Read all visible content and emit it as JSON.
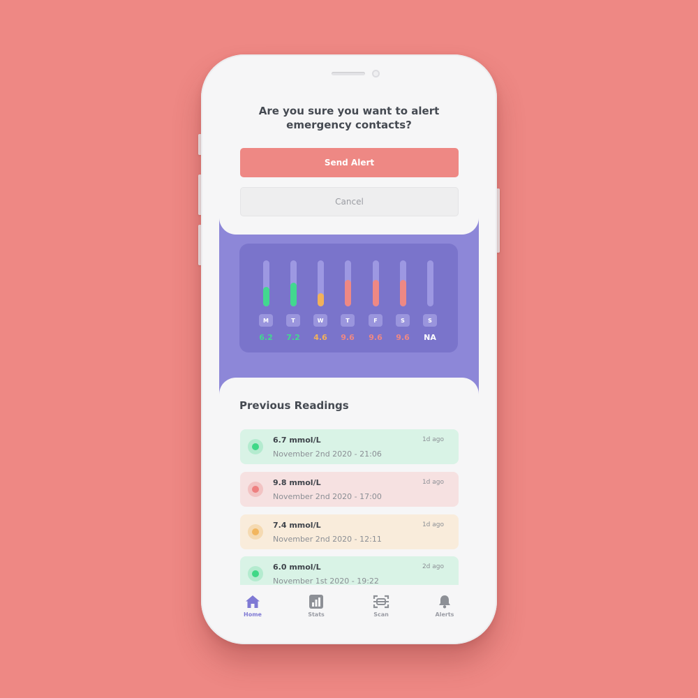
{
  "dialog": {
    "title": "Are you sure you want to alert\nemergency contacts?",
    "send_label": "Send Alert",
    "cancel_label": "Cancel"
  },
  "weekly_chart": {
    "days": [
      {
        "label": "M",
        "value": "6.2",
        "level": 0.42,
        "color": "#42d88f"
      },
      {
        "label": "T",
        "value": "7.2",
        "level": 0.52,
        "color": "#42d88f"
      },
      {
        "label": "W",
        "value": "4.6",
        "level": 0.29,
        "color": "#f2b15a"
      },
      {
        "label": "T",
        "value": "9.6",
        "level": 0.58,
        "color": "#ee8884"
      },
      {
        "label": "F",
        "value": "9.6",
        "level": 0.58,
        "color": "#ee8884"
      },
      {
        "label": "S",
        "value": "9.6",
        "level": 0.58,
        "color": "#ee8884"
      },
      {
        "label": "S",
        "value": "NA",
        "level": 0,
        "color": "#ffffff"
      }
    ]
  },
  "readings": {
    "title": "Previous Readings",
    "items": [
      {
        "value": "6.7 mmol/L",
        "date": "November 2nd 2020 - 21:06",
        "ago": "1d ago",
        "status": "normal",
        "bg": "#d9f3e6",
        "ring": "#b4ebcf",
        "dot": "#3fd887"
      },
      {
        "value": "9.8 mmol/L",
        "date": "November 2nd 2020 - 17:00",
        "ago": "1d ago",
        "status": "high",
        "bg": "#f6e1e1",
        "ring": "#f2c3c3",
        "dot": "#ee8080"
      },
      {
        "value": "7.4 mmol/L",
        "date": "November 2nd 2020 - 12:11",
        "ago": "1d ago",
        "status": "elevated",
        "bg": "#f9ecdb",
        "ring": "#f5dab2",
        "dot": "#f2b65f"
      },
      {
        "value": "6.0 mmol/L",
        "date": "November 1st 2020 - 19:22",
        "ago": "2d ago",
        "status": "normal",
        "bg": "#d9f3e6",
        "ring": "#b4ebcf",
        "dot": "#3fd887"
      }
    ]
  },
  "tabbar": {
    "tabs": [
      {
        "label": "Home",
        "icon": "home-icon",
        "active": true
      },
      {
        "label": "Stats",
        "icon": "stats-icon",
        "active": false
      },
      {
        "label": "Scan",
        "icon": "scan-icon",
        "active": false
      },
      {
        "label": "Alerts",
        "icon": "bell-icon",
        "active": false
      }
    ]
  },
  "colors": {
    "background": "#ee8884",
    "accent": "#8d87d8",
    "alert": "#ee8884"
  }
}
